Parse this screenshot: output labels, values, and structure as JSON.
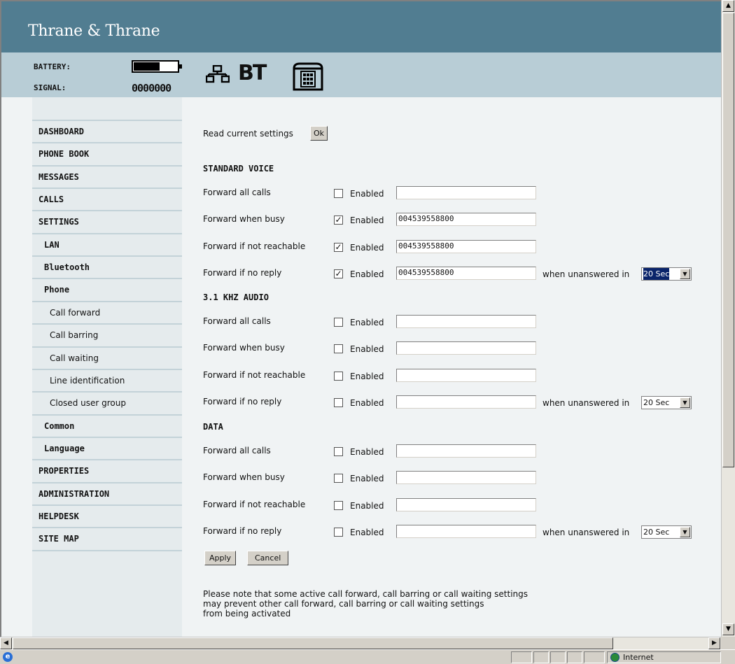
{
  "header": {
    "brand": "Thrane & Thrane"
  },
  "status": {
    "battery_label": "BATTERY:",
    "signal_label": "SIGNAL:",
    "signal_bars": "0000000",
    "battery_level": 0.6
  },
  "sidebar": {
    "items": [
      {
        "label": "DASHBOARD",
        "level": 1
      },
      {
        "label": "PHONE BOOK",
        "level": 1
      },
      {
        "label": "MESSAGES",
        "level": 1
      },
      {
        "label": "CALLS",
        "level": 1
      },
      {
        "label": "SETTINGS",
        "level": 1
      },
      {
        "label": "LAN",
        "level": 2
      },
      {
        "label": "Bluetooth",
        "level": 2
      },
      {
        "label": "Phone",
        "level": 2
      },
      {
        "label": "Call forward",
        "level": 3
      },
      {
        "label": "Call barring",
        "level": 3
      },
      {
        "label": "Call waiting",
        "level": 3
      },
      {
        "label": "Line identification",
        "level": 3
      },
      {
        "label": "Closed user group",
        "level": 3
      },
      {
        "label": "Common",
        "level": 2
      },
      {
        "label": "Language",
        "level": 2
      },
      {
        "label": "PROPERTIES",
        "level": 1
      },
      {
        "label": "ADMINISTRATION",
        "level": 1
      },
      {
        "label": "HELPDESK",
        "level": 1
      },
      {
        "label": "SITE MAP",
        "level": 1
      }
    ]
  },
  "form": {
    "read_label": "Read current settings",
    "ok_label": "Ok",
    "enabled_label": "Enabled",
    "when_unanswered_label": "when unanswered in",
    "sections": [
      {
        "title": "STANDARD VOICE",
        "rows": [
          {
            "label": "Forward all calls",
            "checked": false,
            "number": ""
          },
          {
            "label": "Forward when busy",
            "checked": true,
            "number": "004539558800"
          },
          {
            "label": "Forward if not reachable",
            "checked": true,
            "number": "004539558800"
          },
          {
            "label": "Forward if no reply",
            "checked": true,
            "number": "004539558800",
            "delay": "20 Sec",
            "delay_focused": true
          }
        ]
      },
      {
        "title": "3.1 KHZ AUDIO",
        "rows": [
          {
            "label": "Forward all calls",
            "checked": false,
            "number": ""
          },
          {
            "label": "Forward when busy",
            "checked": false,
            "number": ""
          },
          {
            "label": "Forward if not reachable",
            "checked": false,
            "number": ""
          },
          {
            "label": "Forward if no reply",
            "checked": false,
            "number": "",
            "delay": "20 Sec",
            "delay_focused": false
          }
        ]
      },
      {
        "title": "DATA",
        "rows": [
          {
            "label": "Forward all calls",
            "checked": false,
            "number": ""
          },
          {
            "label": "Forward when busy",
            "checked": false,
            "number": ""
          },
          {
            "label": "Forward if not reachable",
            "checked": false,
            "number": ""
          },
          {
            "label": "Forward if no reply",
            "checked": false,
            "number": "",
            "delay": "20 Sec",
            "delay_focused": false
          }
        ]
      }
    ],
    "apply_label": "Apply",
    "cancel_label": "Cancel",
    "note_lines": [
      "Please note that some active call forward, call barring or call waiting settings",
      "may prevent other call forward, call barring or call waiting settings",
      "from being activated"
    ]
  },
  "browser": {
    "zone_label": "Internet"
  }
}
